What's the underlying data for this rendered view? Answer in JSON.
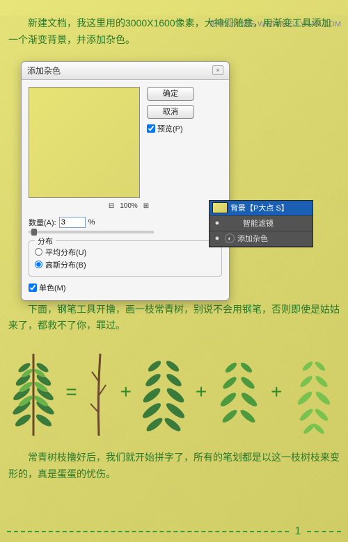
{
  "watermark": "思缘设计论坛  WWW.MISSYUAN.COM",
  "paragraphs": {
    "p1_a": "新建文档",
    "p1_b": "，我这里用的3000X1600像素，大神们随意，用渐变工具添加一个渐变背景，并添加杂色。",
    "p2": "下面，钢笔工具开撸，画一枝常青树，别说不会用钢笔，否则即使是姑姑来了，都救不了你，罪过。",
    "p3": "常青树枝撸好后，我们就开始拼字了，所有的笔划都是以这一枝树枝来变形的，真是蛋蛋的忧伤。"
  },
  "dialog": {
    "title": "添加杂色",
    "ok": "确定",
    "cancel": "取消",
    "preview_label": "预览(P)",
    "zoom_minus": "⊟",
    "zoom_plus": "⊞",
    "zoom_value": "100%",
    "amount_label": "数量(A):",
    "amount_value": "3",
    "amount_unit": "%",
    "group_legend": "分布",
    "uniform": "平均分布(U)",
    "gaussian": "高斯分布(B)",
    "mono": "单色(M)"
  },
  "layers": {
    "row1": "背景【P大点 S】",
    "row2": "智能滤镜",
    "row3": "添加杂色",
    "eye": "●",
    "fx": "◐"
  },
  "formula": {
    "eq": "=",
    "plus": "+"
  },
  "footer": {
    "page": "1"
  }
}
